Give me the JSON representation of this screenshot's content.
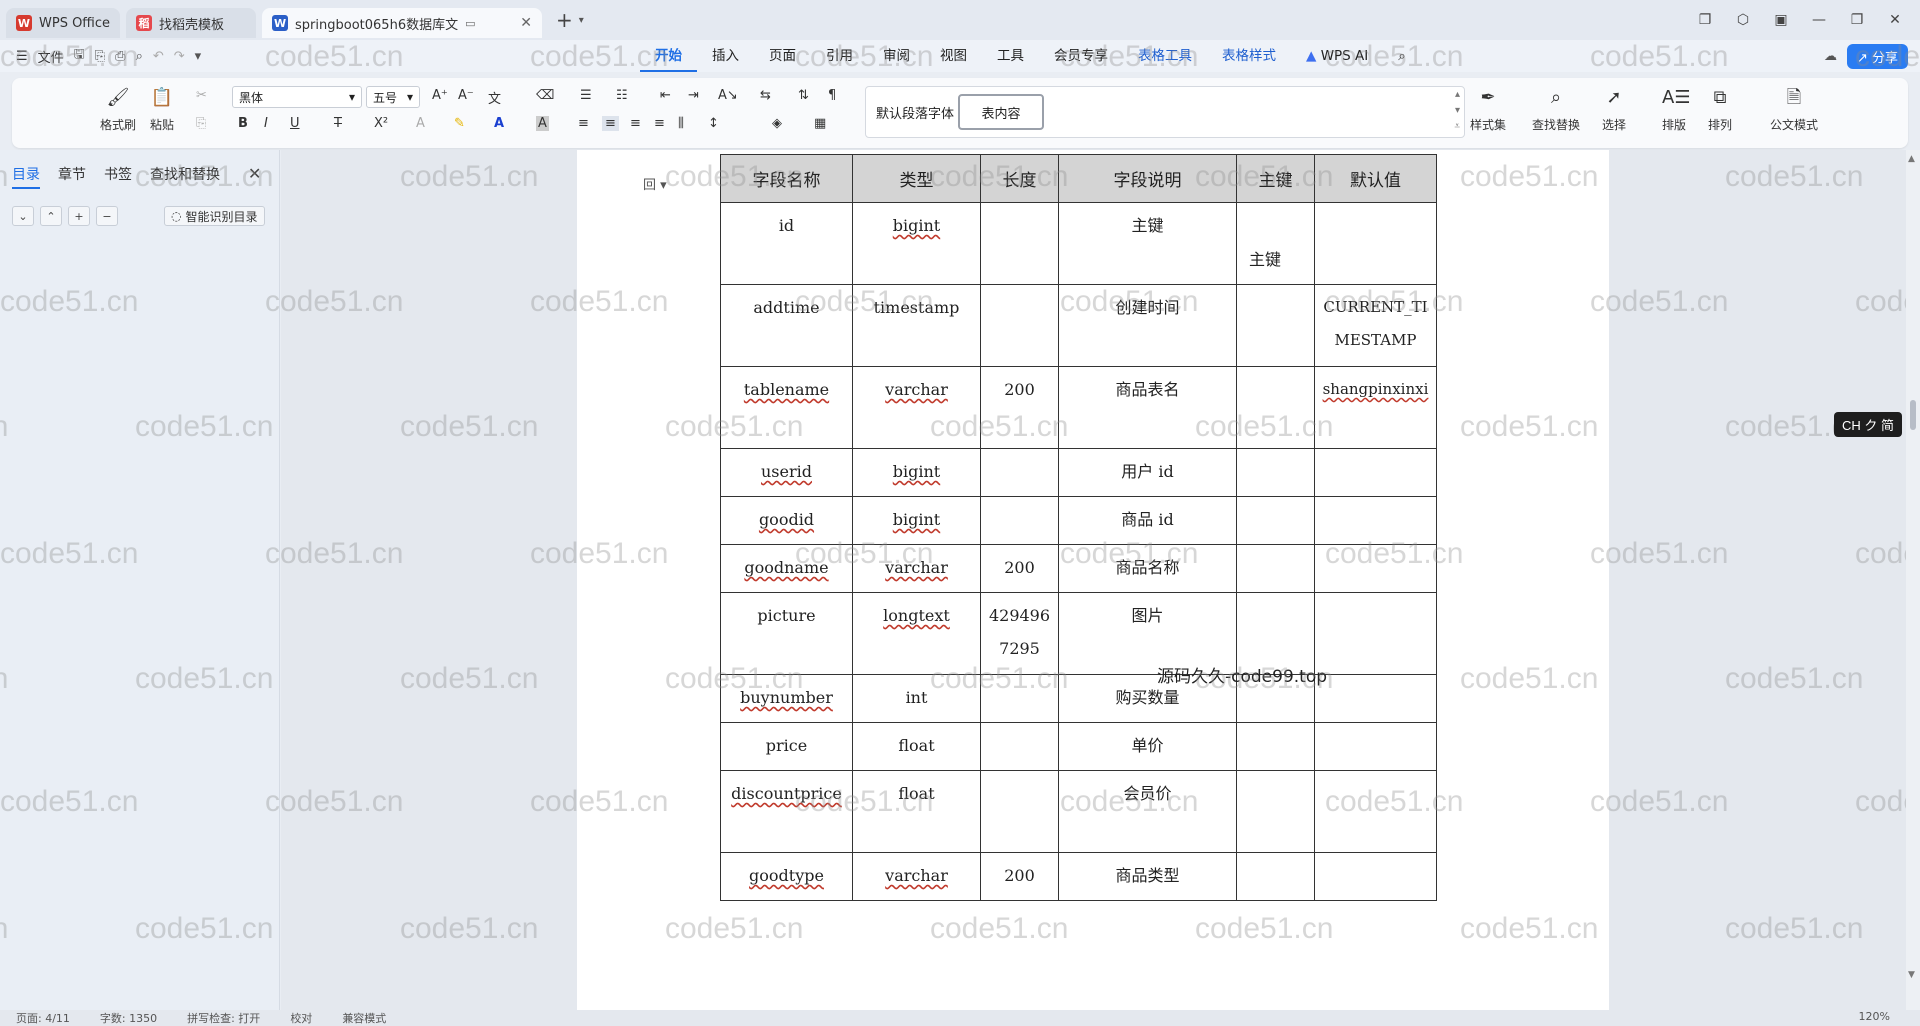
{
  "titlebar": {
    "tabs": [
      {
        "label": "WPS Office",
        "logo": "W",
        "logo_color": "#d63a2f",
        "active": false
      },
      {
        "label": "找稻壳模板",
        "logo": "稻",
        "logo_color": "#e5484d",
        "active": false
      },
      {
        "label": "springboot065h6数据库文",
        "logo": "W",
        "logo_color": "#2b5fc7",
        "active": true
      }
    ],
    "add_tab": "+",
    "window_controls": [
      "restore-icon",
      "box-icon",
      "avatar-icon",
      "minimize-icon",
      "maximize-icon",
      "close-icon"
    ]
  },
  "menubar": {
    "file_label": "文件",
    "tabs": [
      "开始",
      "插入",
      "页面",
      "引用",
      "审阅",
      "视图",
      "工具",
      "会员专享",
      "表格工具",
      "表格样式"
    ],
    "active_tab": "开始",
    "wps_ai": "WPS AI",
    "share": "分享"
  },
  "ribbon": {
    "format_painter": "格式刷",
    "paste": "粘贴",
    "font_name": "黑体",
    "font_size": "五号",
    "styles": [
      "默认段落字体",
      "表内容"
    ],
    "style_set": "样式集",
    "find_replace": "查找替换",
    "select": "选择",
    "layout": "排版",
    "arrange": "排列",
    "official_mode": "公文模式"
  },
  "navpanel": {
    "tabs": [
      "目录",
      "章节",
      "书签",
      "查找和替换"
    ],
    "smart_toc": "智能识别目录"
  },
  "table": {
    "headers": [
      "字段名称",
      "类型",
      "长度",
      "字段说明",
      "主键",
      "默认值"
    ],
    "rows": [
      {
        "name": "id",
        "type": "bigint",
        "length": "",
        "desc": "主键",
        "pk": "主键",
        "default": "",
        "tall": true
      },
      {
        "name": "addtime",
        "type": "timestamp",
        "length": "",
        "desc": "创建时间",
        "pk": "",
        "default": "CURRENT_TIMESTAMP",
        "tall": true
      },
      {
        "name": "tablename",
        "type": "varchar",
        "length": "200",
        "desc": "商品表名",
        "pk": "",
        "default": "shangpinxinxi",
        "tall": true
      },
      {
        "name": "userid",
        "type": "bigint",
        "length": "",
        "desc": "用户 id",
        "pk": "",
        "default": "",
        "tall": false
      },
      {
        "name": "goodid",
        "type": "bigint",
        "length": "",
        "desc": "商品 id",
        "pk": "",
        "default": "",
        "tall": false
      },
      {
        "name": "goodname",
        "type": "varchar",
        "length": "200",
        "desc": "商品名称",
        "pk": "",
        "default": "",
        "tall": false
      },
      {
        "name": "picture",
        "type": "longtext",
        "length": "4294967295",
        "desc": "图片",
        "pk": "",
        "default": "",
        "tall": true
      },
      {
        "name": "buynumber",
        "type": "int",
        "length": "",
        "desc": "购买数量",
        "pk": "",
        "default": "",
        "tall": false
      },
      {
        "name": "price",
        "type": "float",
        "length": "",
        "desc": "单价",
        "pk": "",
        "default": "",
        "tall": false
      },
      {
        "name": "discountprice",
        "type": "float",
        "length": "",
        "desc": "会员价",
        "pk": "",
        "default": "",
        "tall": true
      },
      {
        "name": "goodtype",
        "type": "varchar",
        "length": "200",
        "desc": "商品类型",
        "pk": "",
        "default": "",
        "tall": false
      }
    ]
  },
  "overlay_text": "源码久久-code99.top",
  "watermark": "code51.cn",
  "ime": "CH ク 简",
  "statusbar": {
    "left": [
      "页面: 4/11",
      "字数: 1350",
      "拼写检查: 打开",
      "校对",
      "兼容模式"
    ],
    "zoom": "120%"
  }
}
